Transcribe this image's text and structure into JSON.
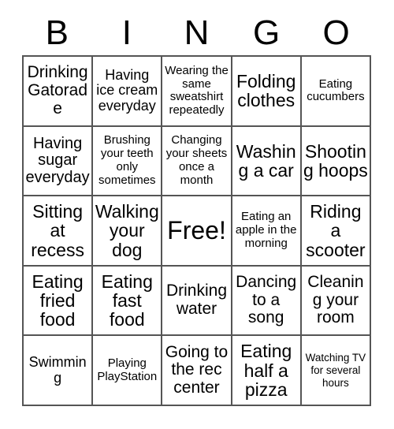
{
  "card": {
    "title": "BINGO",
    "header_letters": [
      "B",
      "I",
      "N",
      "G",
      "O"
    ],
    "grid_size": "5x5",
    "colors": {
      "background": "#ffffff",
      "text": "#000000",
      "border": "#555555"
    },
    "rows": [
      [
        {
          "text": "Drinking Gatorade",
          "size": "lg",
          "free": false
        },
        {
          "text": "Having ice cream everyday",
          "size": "md",
          "free": false
        },
        {
          "text": "Wearing the same sweatshirt repeatedly",
          "size": "sm",
          "free": false
        },
        {
          "text": "Folding clothes",
          "size": "xl",
          "free": false
        },
        {
          "text": "Eating cucumbers",
          "size": "sm",
          "free": false
        }
      ],
      [
        {
          "text": "Having sugar everyday",
          "size": "lg",
          "free": false
        },
        {
          "text": "Brushing your teeth only sometimes",
          "size": "sm",
          "free": false
        },
        {
          "text": "Changing your sheets once a month",
          "size": "sm",
          "free": false
        },
        {
          "text": "Washing a car",
          "size": "xl",
          "free": false
        },
        {
          "text": "Shooting hoops",
          "size": "xl",
          "free": false
        }
      ],
      [
        {
          "text": "Sitting at recess",
          "size": "xl",
          "free": false
        },
        {
          "text": "Walking your dog",
          "size": "xl",
          "free": false
        },
        {
          "text": "Free!",
          "size": "free",
          "free": true
        },
        {
          "text": "Eating an apple in the morning",
          "size": "sm",
          "free": false
        },
        {
          "text": "Riding a scooter",
          "size": "xl",
          "free": false
        }
      ],
      [
        {
          "text": "Eating fried food",
          "size": "xl",
          "free": false
        },
        {
          "text": "Eating fast food",
          "size": "xl",
          "free": false
        },
        {
          "text": "Drinking water",
          "size": "lg",
          "free": false
        },
        {
          "text": "Dancing to a song",
          "size": "lg",
          "free": false
        },
        {
          "text": "Cleaning your room",
          "size": "lg",
          "free": false
        }
      ],
      [
        {
          "text": "Swimming",
          "size": "md",
          "free": false
        },
        {
          "text": "Playing PlayStation",
          "size": "sm",
          "free": false
        },
        {
          "text": "Going to the rec center",
          "size": "lg",
          "free": false
        },
        {
          "text": "Eating half a pizza",
          "size": "xl",
          "free": false
        },
        {
          "text": "Watching TV for several hours",
          "size": "xs",
          "free": false
        }
      ]
    ]
  }
}
